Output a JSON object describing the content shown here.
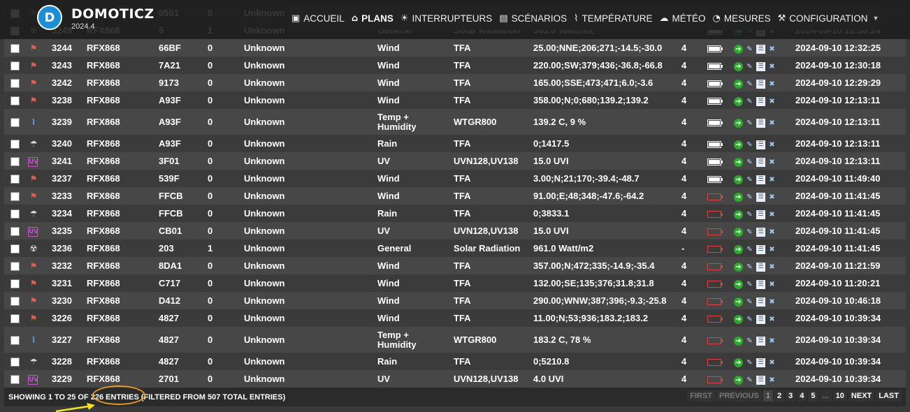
{
  "header": {
    "brand": "DOMOTICZ",
    "version": "2024.4",
    "nav": [
      {
        "label": "ACCUEIL",
        "icon": "home-screen-icon",
        "glyph": "▣",
        "active": false
      },
      {
        "label": "PLANS",
        "icon": "house-icon",
        "glyph": "⌂",
        "active": true
      },
      {
        "label": "INTERRUPTEURS",
        "icon": "lightbulb-icon",
        "glyph": "☀",
        "active": false
      },
      {
        "label": "SCÉNARIOS",
        "icon": "clapperboard-icon",
        "glyph": "▤",
        "active": false
      },
      {
        "label": "TEMPÉRATURE",
        "icon": "thermometer-icon",
        "glyph": "⌇",
        "active": false
      },
      {
        "label": "MÉTÉO",
        "icon": "weather-cloud-icon",
        "glyph": "☁",
        "active": false
      },
      {
        "label": "MESURES",
        "icon": "gauge-icon",
        "glyph": "◔",
        "active": false
      },
      {
        "label": "CONFIGURATION",
        "icon": "tools-icon",
        "glyph": "⚒",
        "active": false,
        "dropdown": true
      }
    ]
  },
  "rows": [
    {
      "icon": "wind",
      "idx": "",
      "hw": "",
      "id": "0501",
      "unit": "0",
      "name": "Unknown",
      "type": "",
      "subtype": "",
      "data": "",
      "signal": "",
      "batt": "full",
      "last": "2024-09-10 12:36:24"
    },
    {
      "icon": "solar",
      "idx": "3249",
      "hw": "RFX868",
      "id": "5",
      "unit": "1",
      "name": "Unknown",
      "type": "General",
      "subtype": "Solar Radiation",
      "data": "363.0 Watt/m2",
      "signal": "",
      "batt": "full",
      "last": "2024-09-10 12:36:24"
    },
    {
      "icon": "wind",
      "idx": "3244",
      "hw": "RFX868",
      "id": "66BF",
      "unit": "0",
      "name": "Unknown",
      "type": "Wind",
      "subtype": "TFA",
      "data": "25.00;NNE;206;271;-14.5;-30.0",
      "signal": "4",
      "batt": "full",
      "last": "2024-09-10 12:32:25"
    },
    {
      "icon": "wind",
      "idx": "3243",
      "hw": "RFX868",
      "id": "7A21",
      "unit": "0",
      "name": "Unknown",
      "type": "Wind",
      "subtype": "TFA",
      "data": "220.00;SW;379;436;-36.8;-66.8",
      "signal": "4",
      "batt": "full",
      "last": "2024-09-10 12:30:18"
    },
    {
      "icon": "wind",
      "idx": "3242",
      "hw": "RFX868",
      "id": "9173",
      "unit": "0",
      "name": "Unknown",
      "type": "Wind",
      "subtype": "TFA",
      "data": "165.00;SSE;473;471;6.0;-3.6",
      "signal": "4",
      "batt": "full",
      "last": "2024-09-10 12:29:29"
    },
    {
      "icon": "wind",
      "idx": "3238",
      "hw": "RFX868",
      "id": "A93F",
      "unit": "0",
      "name": "Unknown",
      "type": "Wind",
      "subtype": "TFA",
      "data": "358.00;N;0;680;139.2;139.2",
      "signal": "4",
      "batt": "full",
      "last": "2024-09-10 12:13:11"
    },
    {
      "icon": "temp",
      "idx": "3239",
      "hw": "RFX868",
      "id": "A93F",
      "unit": "0",
      "name": "Unknown",
      "type": "Temp + Humidity",
      "subtype": "WTGR800",
      "data": "139.2 C, 9 %",
      "signal": "4",
      "batt": "full",
      "last": "2024-09-10 12:13:11",
      "tall": true
    },
    {
      "icon": "rain",
      "idx": "3240",
      "hw": "RFX868",
      "id": "A93F",
      "unit": "0",
      "name": "Unknown",
      "type": "Rain",
      "subtype": "TFA",
      "data": "0;1417.5",
      "signal": "4",
      "batt": "full",
      "last": "2024-09-10 12:13:11"
    },
    {
      "icon": "uv",
      "idx": "3241",
      "hw": "RFX868",
      "id": "3F01",
      "unit": "0",
      "name": "Unknown",
      "type": "UV",
      "subtype": "UVN128,UV138",
      "data": "15.0 UVI",
      "signal": "4",
      "batt": "full",
      "last": "2024-09-10 12:13:11"
    },
    {
      "icon": "wind",
      "idx": "3237",
      "hw": "RFX868",
      "id": "539F",
      "unit": "0",
      "name": "Unknown",
      "type": "Wind",
      "subtype": "TFA",
      "data": "3.00;N;21;170;-39.4;-48.7",
      "signal": "4",
      "batt": "full",
      "last": "2024-09-10 11:49:40"
    },
    {
      "icon": "wind",
      "idx": "3233",
      "hw": "RFX868",
      "id": "FFCB",
      "unit": "0",
      "name": "Unknown",
      "type": "Wind",
      "subtype": "TFA",
      "data": "91.00;E;48;348;-47.6;-64.2",
      "signal": "4",
      "batt": "low",
      "last": "2024-09-10 11:41:45"
    },
    {
      "icon": "rain",
      "idx": "3234",
      "hw": "RFX868",
      "id": "FFCB",
      "unit": "0",
      "name": "Unknown",
      "type": "Rain",
      "subtype": "TFA",
      "data": "0;3833.1",
      "signal": "4",
      "batt": "low",
      "last": "2024-09-10 11:41:45"
    },
    {
      "icon": "uv",
      "idx": "3235",
      "hw": "RFX868",
      "id": "CB01",
      "unit": "0",
      "name": "Unknown",
      "type": "UV",
      "subtype": "UVN128,UV138",
      "data": "15.0 UVI",
      "signal": "4",
      "batt": "low",
      "last": "2024-09-10 11:41:45"
    },
    {
      "icon": "solar",
      "idx": "3236",
      "hw": "RFX868",
      "id": "203",
      "unit": "1",
      "name": "Unknown",
      "type": "General",
      "subtype": "Solar Radiation",
      "data": "961.0 Watt/m2",
      "signal": "-",
      "batt": "low",
      "last": "2024-09-10 11:41:45"
    },
    {
      "icon": "wind",
      "idx": "3232",
      "hw": "RFX868",
      "id": "8DA1",
      "unit": "0",
      "name": "Unknown",
      "type": "Wind",
      "subtype": "TFA",
      "data": "357.00;N;472;335;-14.9;-35.4",
      "signal": "4",
      "batt": "low",
      "last": "2024-09-10 11:21:59"
    },
    {
      "icon": "wind",
      "idx": "3231",
      "hw": "RFX868",
      "id": "C717",
      "unit": "0",
      "name": "Unknown",
      "type": "Wind",
      "subtype": "TFA",
      "data": "132.00;SE;135;376;31.8;31.8",
      "signal": "4",
      "batt": "low",
      "last": "2024-09-10 11:20:21"
    },
    {
      "icon": "wind",
      "idx": "3230",
      "hw": "RFX868",
      "id": "D412",
      "unit": "0",
      "name": "Unknown",
      "type": "Wind",
      "subtype": "TFA",
      "data": "290.00;WNW;387;396;-9.3;-25.8",
      "signal": "4",
      "batt": "low",
      "last": "2024-09-10 10:46:18"
    },
    {
      "icon": "wind",
      "idx": "3226",
      "hw": "RFX868",
      "id": "4827",
      "unit": "0",
      "name": "Unknown",
      "type": "Wind",
      "subtype": "TFA",
      "data": "11.00;N;53;936;183.2;183.2",
      "signal": "4",
      "batt": "low",
      "last": "2024-09-10 10:39:34"
    },
    {
      "icon": "temp",
      "idx": "3227",
      "hw": "RFX868",
      "id": "4827",
      "unit": "0",
      "name": "Unknown",
      "type": "Temp + Humidity",
      "subtype": "WTGR800",
      "data": "183.2 C, 78 %",
      "signal": "4",
      "batt": "low",
      "last": "2024-09-10 10:39:34",
      "tall": true
    },
    {
      "icon": "rain",
      "idx": "3228",
      "hw": "RFX868",
      "id": "4827",
      "unit": "0",
      "name": "Unknown",
      "type": "Rain",
      "subtype": "TFA",
      "data": "0;5210.8",
      "signal": "4",
      "batt": "low",
      "last": "2024-09-10 10:39:34"
    },
    {
      "icon": "uv",
      "idx": "3229",
      "hw": "RFX868",
      "id": "2701",
      "unit": "0",
      "name": "Unknown",
      "type": "UV",
      "subtype": "UVN128,UV138",
      "data": "4.0 UVI",
      "signal": "4",
      "batt": "low",
      "last": "2024-09-10 10:39:34"
    }
  ],
  "footer": {
    "info": "SHOWING 1 TO 25 OF 226 ENTRIES (FILTERED FROM 507 TOTAL ENTRIES)",
    "pager": [
      {
        "label": "FIRST",
        "state": "disabled"
      },
      {
        "label": "PREVIOUS",
        "state": "disabled"
      },
      {
        "label": "1",
        "state": "current"
      },
      {
        "label": "2",
        "state": "link"
      },
      {
        "label": "3",
        "state": "link"
      },
      {
        "label": "4",
        "state": "link"
      },
      {
        "label": "5",
        "state": "link"
      },
      {
        "label": "...",
        "state": "disabled"
      },
      {
        "label": "10",
        "state": "link"
      },
      {
        "label": "NEXT",
        "state": "link"
      },
      {
        "label": "LAST",
        "state": "link"
      }
    ]
  },
  "colors": {
    "accent_blue": "#1a8fd6",
    "battery_low": "#e04040",
    "highlight": "#e89a26",
    "arrow": "#f5e51a"
  }
}
